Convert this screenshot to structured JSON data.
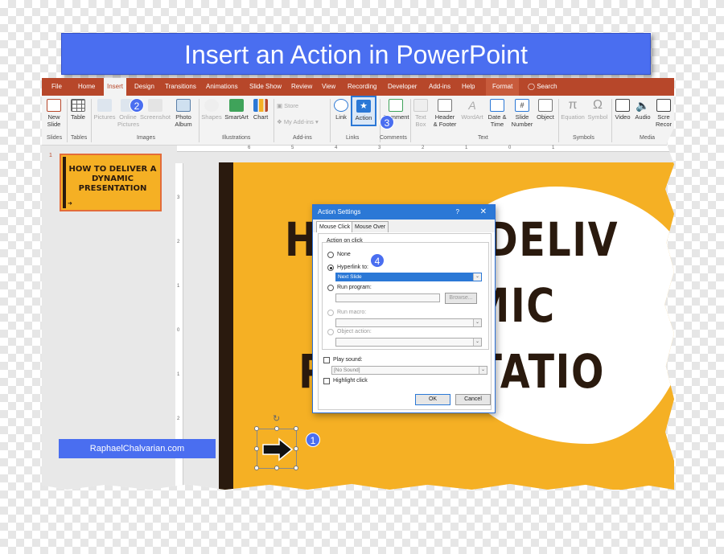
{
  "banner": {
    "title": "Insert an Action in PowerPoint"
  },
  "tabs": [
    "File",
    "Home",
    "Insert",
    "Design",
    "Transitions",
    "Animations",
    "Slide Show",
    "Review",
    "View",
    "Recording",
    "Developer",
    "Add-ins",
    "Help",
    "Format"
  ],
  "search": {
    "label": "Search"
  },
  "ribbon": {
    "new_slide": [
      "New",
      "Slide"
    ],
    "table": "Table",
    "pictures": "Pictures",
    "online_pictures": [
      "Online",
      "Pictures"
    ],
    "screenshot": "Screenshot",
    "photo_album": [
      "Photo",
      "Album"
    ],
    "shapes": "Shapes",
    "smartart": "SmartArt",
    "chart": "Chart",
    "store": "Store",
    "my_addins": "My Add-ins",
    "link": "Link",
    "action": "Action",
    "comment": "Comment",
    "text_box": [
      "Text",
      "Box"
    ],
    "header_footer": [
      "Header",
      "& Footer"
    ],
    "wordart": "WordArt",
    "date_time": [
      "Date &",
      "Time"
    ],
    "slide_number": [
      "Slide",
      "Number"
    ],
    "object": "Object",
    "equation": "Equation",
    "symbol": "Symbol",
    "video": "Video",
    "audio": "Audio",
    "screen_recording": "Scre Recor",
    "groups": [
      "Slides",
      "Tables",
      "Images",
      "Illustrations",
      "Add-ins",
      "Links",
      "Comments",
      "Text",
      "Symbols",
      "Media"
    ]
  },
  "ruler_h": [
    "6",
    "5",
    "4",
    "3",
    "2",
    "1",
    "0",
    "1"
  ],
  "ruler_v": [
    "3",
    "2",
    "1",
    "0",
    "1",
    "2"
  ],
  "thumbnail": {
    "number": "1",
    "title": "HOW TO DELIVER A DYNAMIC PRESENTATION"
  },
  "slide_text": {
    "line1": "HOW TO DELIV",
    "line2": "DYNAMIC",
    "line3": "PRESENTATIO"
  },
  "badges": [
    "1",
    "2",
    "3",
    "4"
  ],
  "watermark": "RaphaelChalvarian.com",
  "dialog": {
    "title": "Action Settings",
    "help": "?",
    "close": "✕",
    "tabs": [
      "Mouse Click",
      "Mouse Over"
    ],
    "group_label": "Action on click",
    "none": "None",
    "hyperlink": "Hyperlink to:",
    "hyperlink_value": "Next Slide",
    "run_program": "Run program:",
    "browse": "Browse...",
    "run_macro": "Run macro:",
    "object_action": "Object action:",
    "play_sound": "Play sound:",
    "sound_value": "[No Sound]",
    "highlight": "Highlight click",
    "ok": "OK",
    "cancel": "Cancel"
  },
  "colors": {
    "ribbon_tab": "#b7472a",
    "accent": "#4a6ef0",
    "slide_bg": "#f5b024",
    "slide_dark": "#2a1a0e",
    "dialog_title": "#2b78d6"
  }
}
